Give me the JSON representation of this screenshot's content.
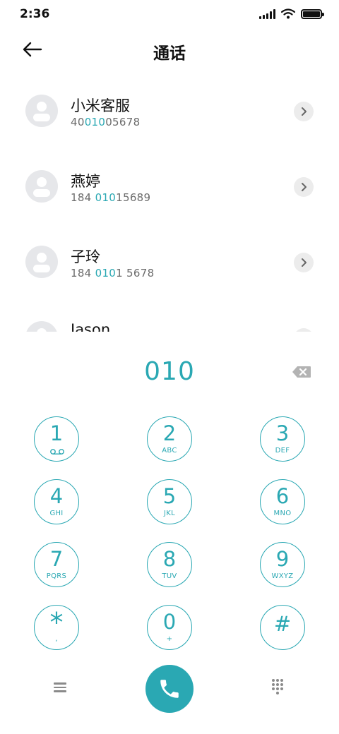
{
  "status_bar": {
    "time": "2:36"
  },
  "header": {
    "title": "通话"
  },
  "contacts": [
    {
      "name": "小米客服",
      "number_before": "40",
      "number_match": "010",
      "number_after": "05678"
    },
    {
      "name": "燕婷",
      "number_before": "184 ",
      "number_match": "010",
      "number_after": "15689"
    },
    {
      "name": "子玲",
      "number_before": "184 ",
      "number_match": "010",
      "number_after": "1 5678"
    },
    {
      "name": "Jason",
      "number_before": "",
      "number_match": "",
      "number_after": ""
    }
  ],
  "dialer": {
    "dialed_number": "010"
  },
  "keys": [
    {
      "digit": "1",
      "letters": ""
    },
    {
      "digit": "2",
      "letters": "ABC"
    },
    {
      "digit": "3",
      "letters": "DEF"
    },
    {
      "digit": "4",
      "letters": "GHI"
    },
    {
      "digit": "5",
      "letters": "JKL"
    },
    {
      "digit": "6",
      "letters": "MNO"
    },
    {
      "digit": "7",
      "letters": "PQRS"
    },
    {
      "digit": "8",
      "letters": "TUV"
    },
    {
      "digit": "9",
      "letters": "WXYZ"
    },
    {
      "digit": "*",
      "letters": ","
    },
    {
      "digit": "0",
      "letters": "+"
    },
    {
      "digit": "#",
      "letters": ""
    }
  ],
  "icons": {
    "back": "arrow-left-icon",
    "backspace": "backspace-icon",
    "voicemail": "voicemail-icon",
    "menu": "menu-icon",
    "call": "phone-icon",
    "keypad": "dialpad-icon"
  },
  "colors": {
    "accent": "#2aa8b3",
    "text": "#111111",
    "secondary": "#6b6b6b"
  }
}
